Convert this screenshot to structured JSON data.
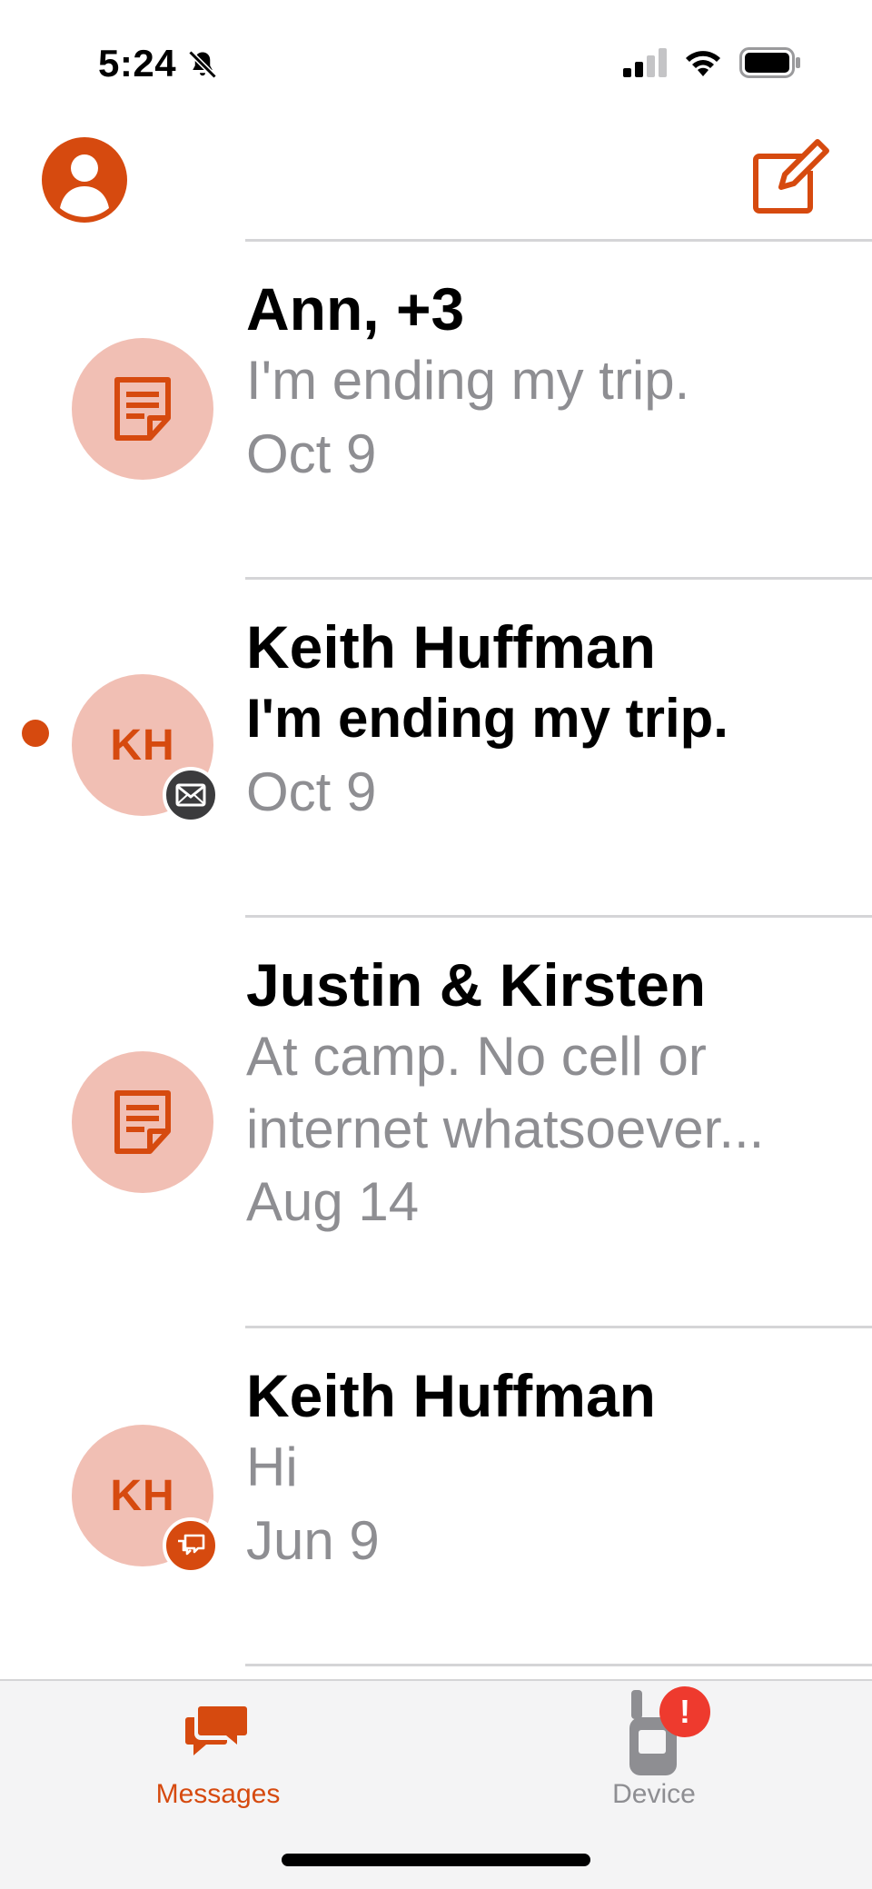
{
  "status_bar": {
    "time": "5:24"
  },
  "colors": {
    "accent": "#d64a0f",
    "avatar_bg": "#f1bfb4",
    "secondary_text": "#8e8e92",
    "alert": "#ee3a2e"
  },
  "header": {
    "profile_icon": "person-circle-icon",
    "compose_icon": "compose-icon"
  },
  "conversations": [
    {
      "title": "Ann, +3",
      "preview": "I'm ending my trip.",
      "date": "Oct 9",
      "avatar_type": "group-note-icon",
      "unread": false
    },
    {
      "title": "Keith Huffman",
      "preview": "I'm ending my trip.",
      "date": "Oct 9",
      "initials": "KH",
      "badge_icon": "envelope-icon",
      "unread": true
    },
    {
      "title": "Justin & Kirsten",
      "preview_line1": "At camp. No cell or",
      "preview_line2": "internet whatsoever...",
      "date": "Aug 14",
      "avatar_type": "group-note-icon",
      "unread": false
    },
    {
      "title": "Keith Huffman",
      "preview": "Hi",
      "date": "Jun 9",
      "initials": "KH",
      "badge_icon": "chat-bubbles-icon",
      "unread": false
    }
  ],
  "tabs": [
    {
      "label": "Messages",
      "icon": "messages-icon",
      "active": true
    },
    {
      "label": "Device",
      "icon": "device-icon",
      "active": false,
      "alert": "!"
    }
  ]
}
